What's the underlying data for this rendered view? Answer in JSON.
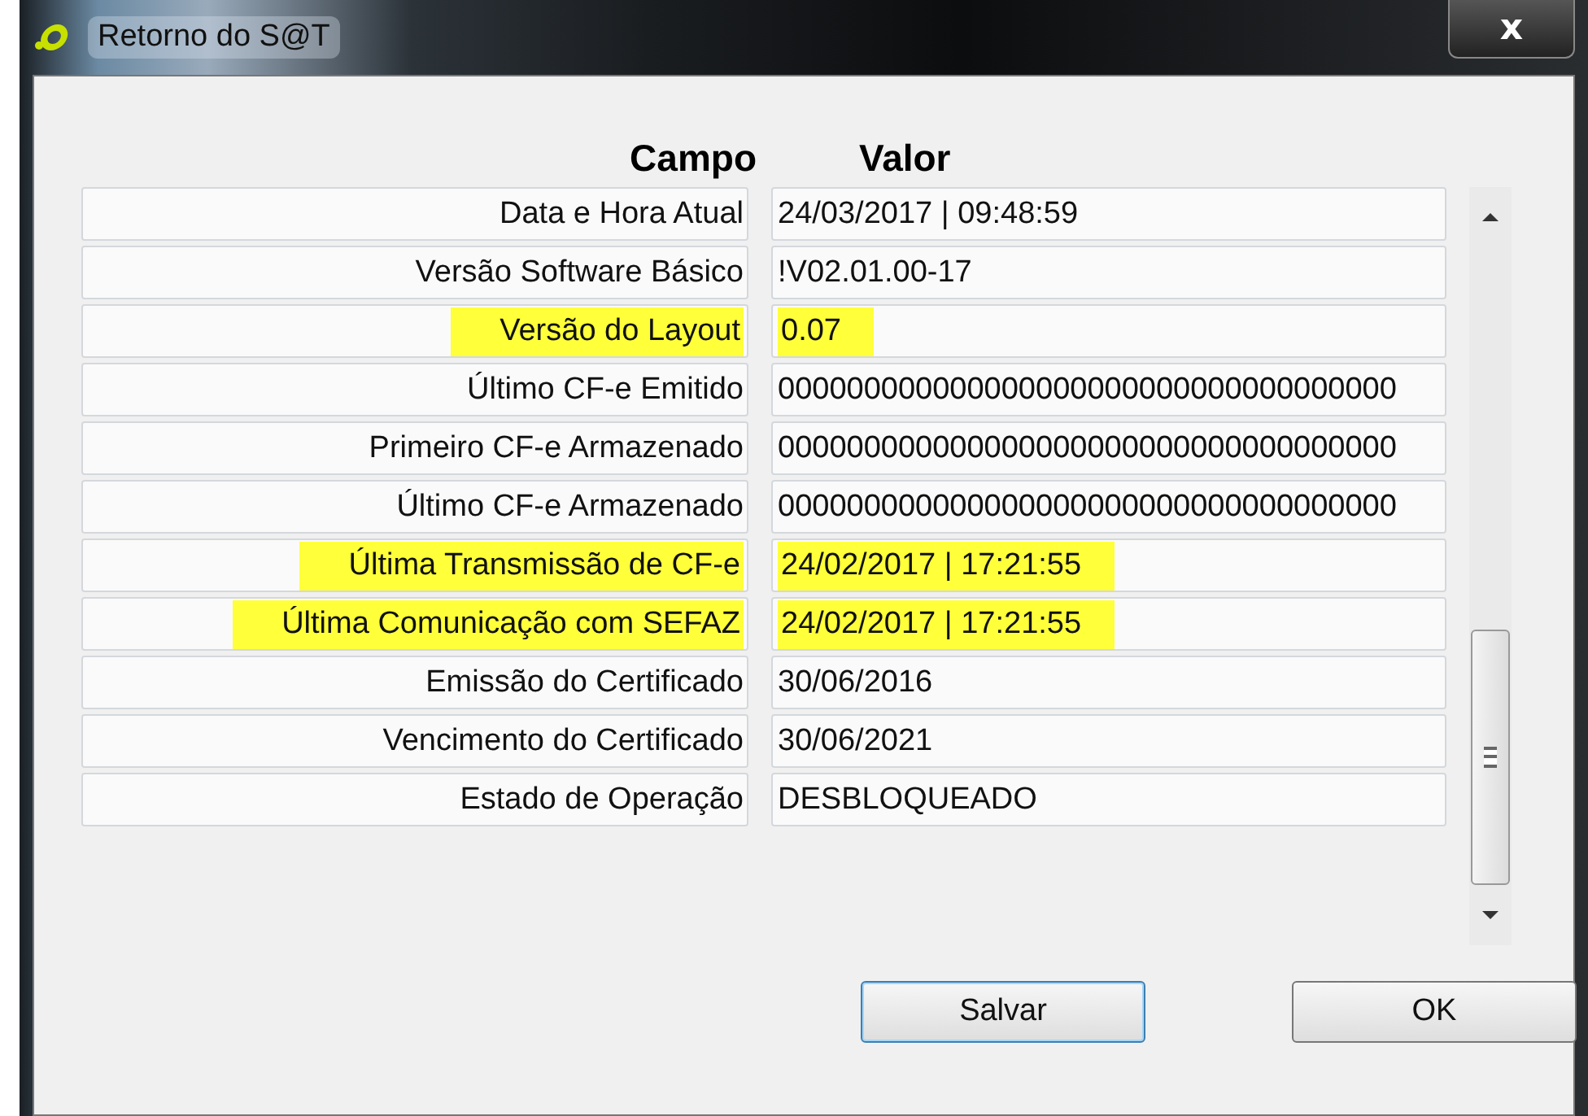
{
  "window": {
    "title": "Retorno do S@T",
    "close": "x"
  },
  "table": {
    "columns": [
      "Campo",
      "Valor"
    ],
    "rows": [
      {
        "field": "Data e Hora Atual",
        "value": "24/03/2017 | 09:48:59",
        "highlighted": false
      },
      {
        "field": "Versão Software Básico",
        "value": "!V02.01.00-17",
        "highlighted": false
      },
      {
        "field": "Versão do Layout",
        "value": "0.07",
        "highlighted": true
      },
      {
        "field": "Último CF-e Emitido",
        "value": "000000000000000000000000000000000000",
        "highlighted": false
      },
      {
        "field": "Primeiro CF-e Armazenado",
        "value": "000000000000000000000000000000000000",
        "highlighted": false
      },
      {
        "field": "Último CF-e Armazenado",
        "value": "000000000000000000000000000000000000",
        "highlighted": false
      },
      {
        "field": "Última Transmissão de CF-e",
        "value": "24/02/2017 | 17:21:55",
        "highlighted": true
      },
      {
        "field": "Última Comunicação com SEFAZ",
        "value": "24/02/2017 | 17:21:55",
        "highlighted": true
      },
      {
        "field": "Emissão do Certificado",
        "value": "30/06/2016",
        "highlighted": false
      },
      {
        "field": "Vencimento do Certificado",
        "value": "30/06/2021",
        "highlighted": false
      },
      {
        "field": "Estado de Operação",
        "value": "DESBLOQUEADO",
        "highlighted": false
      }
    ]
  },
  "buttons": [
    "Salvar",
    "OK"
  ]
}
